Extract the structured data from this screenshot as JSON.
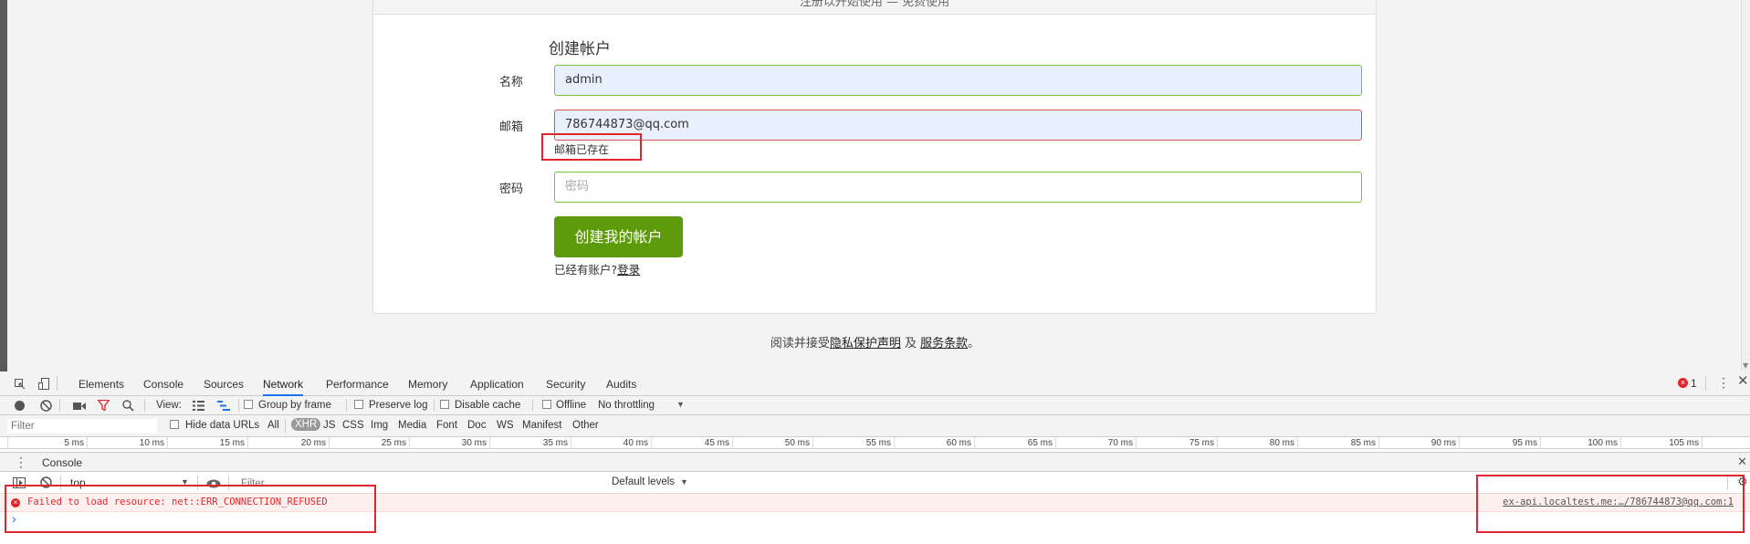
{
  "page": {
    "header_cut_text": "注册以开始使用 — 免费使用",
    "form": {
      "title": "创建帐户",
      "name_label": "名称",
      "name_value": "admin",
      "email_label": "邮箱",
      "email_value": "786744873@qq.com",
      "email_error": "邮箱已存在",
      "password_label": "密码",
      "password_placeholder": "密码",
      "submit_label": "创建我的帐户",
      "have_account": "已经有账户?",
      "login_link": "登录"
    },
    "footer": {
      "prefix": "阅读并接受",
      "privacy_link": "隐私保护声明",
      "and": " 及 ",
      "terms_link": "服务条款",
      "suffix": "。"
    }
  },
  "devtools": {
    "tabs": [
      "Elements",
      "Console",
      "Sources",
      "Network",
      "Performance",
      "Memory",
      "Application",
      "Security",
      "Audits"
    ],
    "active_tab": "Network",
    "error_count": "1",
    "network_toolbar": {
      "view_label": "View:",
      "group_by_frame": "Group by frame",
      "preserve_log": "Preserve log",
      "disable_cache": "Disable cache",
      "offline": "Offline",
      "throttling": "No throttling"
    },
    "filter_bar": {
      "filter_placeholder": "Filter",
      "hide_data_urls": "Hide data URLs",
      "types": [
        "All",
        "XHR",
        "JS",
        "CSS",
        "Img",
        "Media",
        "Font",
        "Doc",
        "WS",
        "Manifest",
        "Other"
      ],
      "active_type": "XHR"
    },
    "timeline_ticks": [
      "5 ms",
      "10 ms",
      "15 ms",
      "20 ms",
      "25 ms",
      "30 ms",
      "35 ms",
      "40 ms",
      "45 ms",
      "50 ms",
      "55 ms",
      "60 ms",
      "65 ms",
      "70 ms",
      "75 ms",
      "80 ms",
      "85 ms",
      "90 ms",
      "95 ms",
      "100 ms",
      "105 ms"
    ],
    "drawer_tab": "Console",
    "console": {
      "context": "top",
      "filter_placeholder": "Filter",
      "levels": "Default levels",
      "error_message": "Failed to load resource: net::ERR_CONNECTION_REFUSED",
      "error_source": "ex-api.localtest.me:…/786744873@qq.com:1",
      "prompt": "›"
    }
  },
  "colors": {
    "accent_green": "#5e9b0a",
    "error_red": "#e0262c",
    "devtools_blue": "#1a73e8"
  }
}
